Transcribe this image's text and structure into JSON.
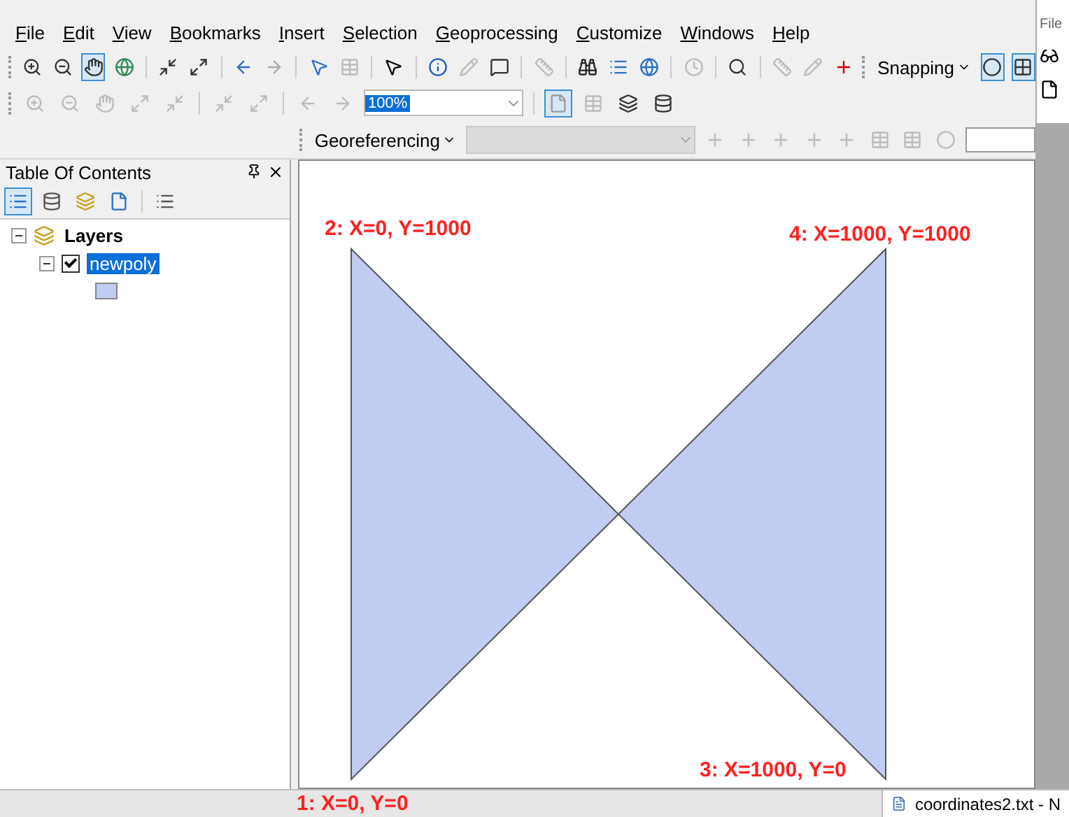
{
  "menu_bar": [
    "File",
    "Edit",
    "View",
    "Bookmarks",
    "Insert",
    "Selection",
    "Geoprocessing",
    "Customize",
    "Windows",
    "Help"
  ],
  "toolbar": {
    "scale_field": "100%",
    "georeferencing": "Georeferencing",
    "snapping": "Snapping"
  },
  "table_of_contents": {
    "title": "Table Of Contents",
    "tree": [
      {
        "label": "Layers",
        "expanded": true,
        "children": [
          {
            "label": "newpoly",
            "expanded": true,
            "checked": true,
            "selected": true
          }
        ]
      }
    ]
  },
  "map": {
    "labels": [
      "2: X=0, Y=1000",
      "4: X=1000, Y=1000",
      "3: X=1000, Y=0",
      "1: X=0, Y=0"
    ]
  },
  "side_window": {
    "menu": "File"
  },
  "taskbar": {
    "window": "coordinates2.txt - N"
  }
}
